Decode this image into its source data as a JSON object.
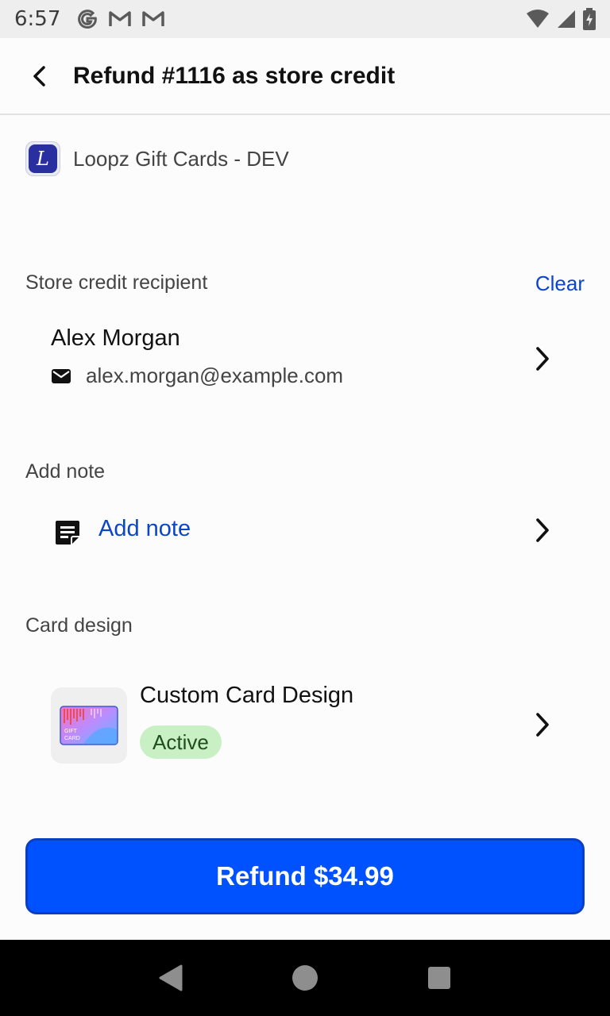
{
  "status_bar": {
    "time": "6:57",
    "left_icons": [
      "google-icon",
      "gmail-icon",
      "gmail-icon"
    ],
    "right_icons": [
      "wifi-icon",
      "cell-signal-icon",
      "battery-charging-icon"
    ]
  },
  "app_bar": {
    "title": "Refund #1116 as store credit"
  },
  "app_source": {
    "name": "Loopz Gift Cards - DEV",
    "logo_letter": "L"
  },
  "recipient_section": {
    "label": "Store credit recipient",
    "clear_label": "Clear",
    "name": "Alex Morgan",
    "email": "alex.morgan@example.com"
  },
  "note_section": {
    "label": "Add note",
    "action_label": "Add note"
  },
  "card_section": {
    "label": "Card design",
    "title": "Custom Card Design",
    "status": "Active",
    "thumb_text": "GIFT CARD"
  },
  "refund_button": {
    "label": "Refund $34.99"
  },
  "colors": {
    "accent": "#0051ff",
    "link": "#0b45c9",
    "badge_bg": "#c9f0c4",
    "badge_text": "#1f4d1e"
  }
}
